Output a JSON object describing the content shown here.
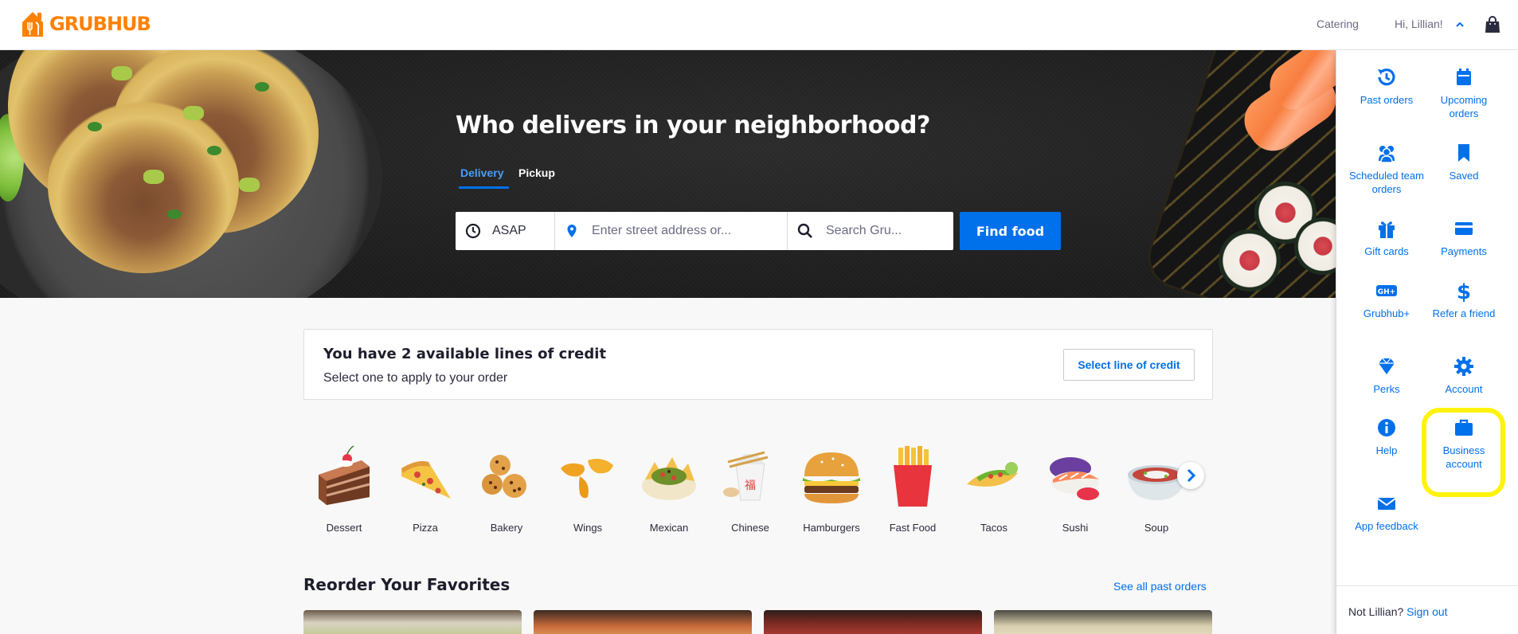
{
  "header": {
    "logo": "GRUBHUB",
    "catering": "Catering",
    "greeting": "Hi, Lillian!"
  },
  "hero": {
    "title": "Who delivers in your neighborhood?",
    "tabs": [
      "Delivery",
      "Pickup"
    ],
    "time_value": "ASAP",
    "address_placeholder": "Enter street address or...",
    "search_placeholder": "Search Gru...",
    "find_button": "Find food"
  },
  "credit": {
    "title": "You have 2 available lines of credit",
    "subtitle": "Select one to apply to your order",
    "button": "Select line of credit"
  },
  "categories": [
    "Dessert",
    "Pizza",
    "Bakery",
    "Wings",
    "Mexican",
    "Chinese",
    "Hamburgers",
    "Fast Food",
    "Tacos",
    "Sushi",
    "Soup"
  ],
  "reorder": {
    "title": "Reorder Your Favorites",
    "see_all": "See all past orders"
  },
  "account_menu": {
    "items": [
      {
        "label": "Past orders",
        "icon": "history-icon"
      },
      {
        "label": "Upcoming orders",
        "icon": "calendar-icon"
      },
      {
        "label": "Scheduled team orders",
        "icon": "team-icon"
      },
      {
        "label": "Saved",
        "icon": "bookmark-icon"
      },
      {
        "label": "Gift cards",
        "icon": "gift-icon"
      },
      {
        "label": "Payments",
        "icon": "credit-card-icon"
      },
      {
        "label": "Grubhub+",
        "icon": "grubhub-plus-icon"
      },
      {
        "label": "Refer a friend",
        "icon": "dollar-icon"
      },
      {
        "label": "Perks",
        "icon": "diamond-icon"
      },
      {
        "label": "Account",
        "icon": "gear-icon"
      },
      {
        "label": "Help",
        "icon": "info-icon"
      },
      {
        "label": "Business account",
        "icon": "briefcase-icon"
      },
      {
        "label": "App feedback",
        "icon": "envelope-icon"
      }
    ],
    "footer_text": "Not Lillian?",
    "sign_out": "Sign out"
  },
  "colors": {
    "brand_orange": "#ff8000",
    "link_blue": "#0070eb",
    "highlight_yellow": "#fff30a"
  }
}
